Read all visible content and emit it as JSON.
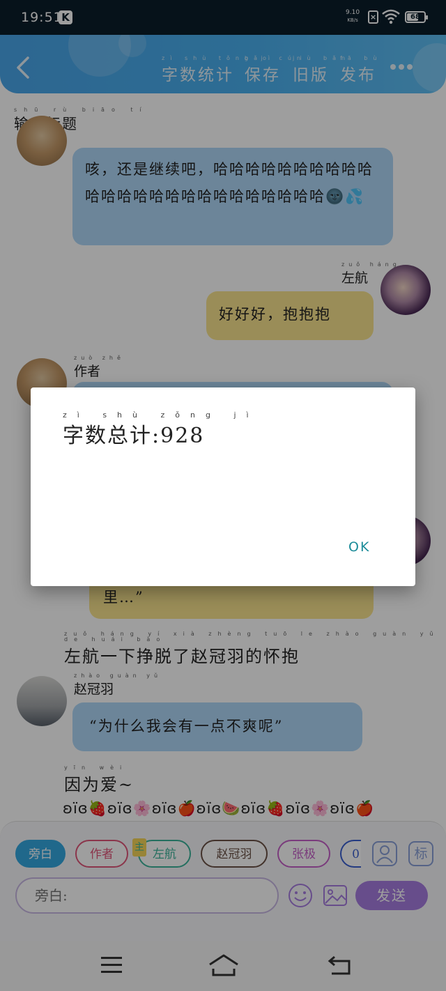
{
  "status_bar": {
    "time": "19:51",
    "app_badge": "K",
    "net_speed": "9.10",
    "net_speed_unit": "KB/s",
    "sim_status": "×",
    "battery": "68",
    "battery_level_percent": 68
  },
  "header": {
    "back_icon": "back-chevron-icon",
    "actions": [
      {
        "label": "字数统计",
        "pinyin": "zì shù tǒng jì"
      },
      {
        "label": "保存",
        "pinyin": "bǎo cún"
      },
      {
        "label": "旧版",
        "pinyin": "jiù bǎn"
      },
      {
        "label": "发布",
        "pinyin": "fā bù"
      }
    ],
    "more_icon": "more-dots-icon"
  },
  "title_field": {
    "label": "输入标题",
    "pinyin": "shū rù biāo tí"
  },
  "messages": [
    {
      "speaker": "",
      "speaker_pinyin": "",
      "text": "咳，还是继续吧，哈哈哈哈哈哈哈哈哈哈哈哈哈哈哈哈哈哈哈哈哈哈哈哈哈🌚💦",
      "color": "blue"
    },
    {
      "speaker": "左航",
      "speaker_pinyin": "zuǒ háng",
      "text": "好好好，抱抱抱",
      "color": "yellow"
    },
    {
      "speaker": "作者",
      "speaker_pinyin": "zuò zhě",
      "text": "",
      "color": "blue"
    },
    {
      "speaker": "",
      "speaker_pinyin": "",
      "text": "里…”",
      "color": "yellow"
    },
    {
      "speaker": "赵冠羽",
      "speaker_pinyin": "zhào guàn yǔ",
      "text": "“为什么我会有一点不爽呢”",
      "color": "blue"
    }
  ],
  "narration_1": {
    "text": "左航一下挣脱了赵冠羽的怀抱",
    "pinyin": "zuǒ háng yí xià zhèng tuō le zhào guàn yǔ de huái bào"
  },
  "narration_2": {
    "text": "因为爱~",
    "pinyin": "yīn wèi"
  },
  "emoji_row": "ʚїɞ🍓ʚїɞ🌸ʚїɞ🍎ʚїɞ🍉ʚїɞ🍓ʚїɞ🌸ʚїɞ🍎",
  "role_chips": [
    {
      "label": "旁白",
      "active": true,
      "color": "#35a8e0"
    },
    {
      "label": "作者",
      "active": false,
      "color": "#e0567a"
    },
    {
      "label": "左航",
      "badge": "主",
      "active": false,
      "color": "#3bb39a"
    },
    {
      "label": "赵冠羽",
      "active": false,
      "color": "#6b5246"
    },
    {
      "label": "张极",
      "active": false,
      "color": "#c560c8"
    },
    {
      "label": "0",
      "active": false,
      "color": "#3a5fd0"
    }
  ],
  "tool_icons": [
    "person-icon",
    "tag-icon"
  ],
  "tag_label": "标",
  "input": {
    "placeholder": "旁白:"
  },
  "bottom_buttons": {
    "emoji_icon": "smiley-icon",
    "image_icon": "image-icon",
    "send_label": "发送"
  },
  "nav": [
    "menu-icon",
    "home-icon",
    "back-icon"
  ],
  "dialog": {
    "message": "字数总计:928",
    "pinyin": "zì shù zǒng jì",
    "ok_label": "OK"
  }
}
